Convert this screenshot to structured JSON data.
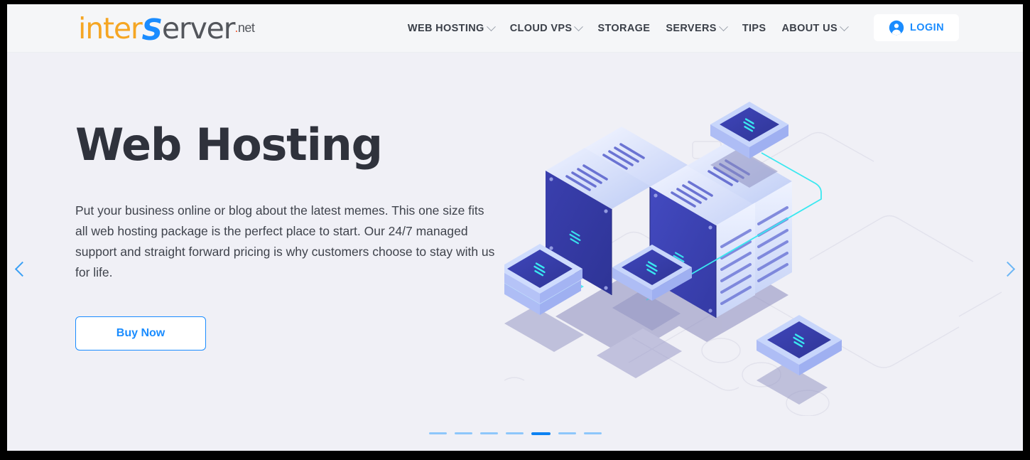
{
  "brand": {
    "logo_inter": "inter",
    "logo_s": "S",
    "logo_erver": "erver",
    "logo_dot": ".",
    "logo_net": "net"
  },
  "header": {
    "nav": [
      {
        "label": "WEB HOSTING",
        "has_dropdown": true
      },
      {
        "label": "CLOUD VPS",
        "has_dropdown": true
      },
      {
        "label": "STORAGE",
        "has_dropdown": false
      },
      {
        "label": "SERVERS",
        "has_dropdown": true
      },
      {
        "label": "TIPS",
        "has_dropdown": false
      },
      {
        "label": "ABOUT US",
        "has_dropdown": true
      }
    ],
    "login_label": "LOGIN",
    "login_icon": "user-circle-icon"
  },
  "hero": {
    "title": "Web Hosting",
    "description": "Put your business online or blog about the latest memes. This one size fits all web hosting package is the perfect place to start. Our 24/7 managed support and straight forward pricing is why customers choose to stay with us for life.",
    "cta_label": "Buy Now",
    "prev_icon": "chevron-left-icon",
    "next_icon": "chevron-right-icon",
    "illustration": "isometric-server-rack-illustration",
    "slide_count": 7,
    "active_slide": 5
  },
  "colors": {
    "accent_blue": "#1a8cff",
    "active_dot": "#0d82f2",
    "inactive_dot": "#8ec7fb",
    "hero_bg": "#f0f0f6",
    "header_bg": "#f5f6f8",
    "title_text": "#2f323c",
    "logo_orange": "#f5a623",
    "logo_red": "#f0603a",
    "server_dark": "#3b3fa8",
    "server_light": "#dfe6fb",
    "cable_cyan": "#3ae8f0"
  }
}
